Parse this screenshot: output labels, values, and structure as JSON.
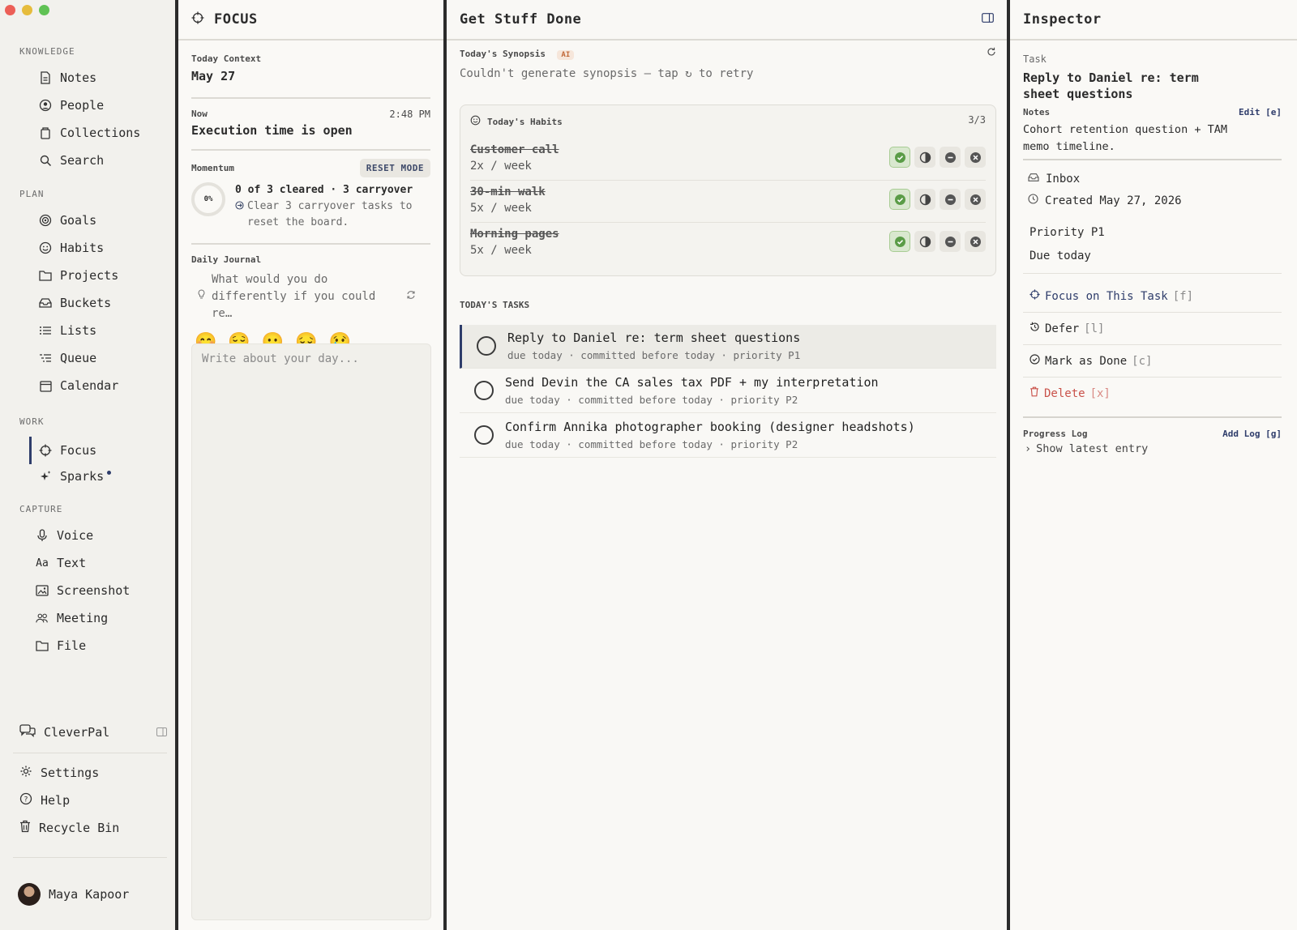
{
  "window": {
    "traffic_colors": [
      "#ec5f57",
      "#e6bc3c",
      "#60c254"
    ]
  },
  "sidebar": {
    "sections": {
      "knowledge": "KNOWLEDGE",
      "plan": "PLAN",
      "work": "WORK",
      "capture": "CAPTURE"
    },
    "knowledge": [
      {
        "label": "Notes",
        "icon": "document-icon"
      },
      {
        "label": "People",
        "icon": "person-circle-icon"
      },
      {
        "label": "Collections",
        "icon": "bucket-icon"
      },
      {
        "label": "Search",
        "icon": "search-icon"
      }
    ],
    "plan": [
      {
        "label": "Goals",
        "icon": "target-icon"
      },
      {
        "label": "Habits",
        "icon": "smile-icon"
      },
      {
        "label": "Projects",
        "icon": "folder-icon"
      },
      {
        "label": "Buckets",
        "icon": "tray-icon"
      },
      {
        "label": "Lists",
        "icon": "list-icon"
      },
      {
        "label": "Queue",
        "icon": "queue-icon"
      },
      {
        "label": "Calendar",
        "icon": "calendar-icon"
      }
    ],
    "work": [
      {
        "label": "Focus",
        "icon": "crosshair-icon",
        "active": true
      },
      {
        "label": "Sparks",
        "icon": "sparkle-icon"
      }
    ],
    "capture": [
      {
        "label": "Voice",
        "icon": "mic-icon"
      },
      {
        "label": "Text",
        "icon": "text-icon",
        "glyph": "Aa"
      },
      {
        "label": "Screenshot",
        "icon": "image-icon"
      },
      {
        "label": "Meeting",
        "icon": "people-icon"
      },
      {
        "label": "File",
        "icon": "folder-icon"
      }
    ],
    "assistant": "CleverPal",
    "settings": "Settings",
    "help": "Help",
    "recycle": "Recycle Bin",
    "user": "Maya Kapoor"
  },
  "focus": {
    "title": "FOCUS",
    "context_label": "Today Context",
    "date": "May 27",
    "now_label": "Now",
    "time": "2:48 PM",
    "status": "Execution time is open",
    "momentum_label": "Momentum",
    "reset_label": "RESET MODE",
    "percent": "0%",
    "cleared": "0 of 3 cleared · 3 carryover",
    "carryover_hint": "Clear 3 carryover tasks to reset the board.",
    "journal_label": "Daily Journal",
    "journal_prompt": "What would you do differently if you could re…",
    "moods": [
      "😊",
      "😌",
      "😐",
      "😔",
      "😢"
    ],
    "journal_placeholder": "Write about your day..."
  },
  "main": {
    "title": "Get Stuff Done",
    "synopsis_label": "Today's Synopsis",
    "ai_badge": "AI",
    "synopsis_text": "Couldn't generate synopsis — tap ↻ to retry",
    "habits_title": "Today's Habits",
    "habits_count": "3/3",
    "habits": [
      {
        "name": "Customer call",
        "freq": "2x / week"
      },
      {
        "name": "30-min walk",
        "freq": "5x / week"
      },
      {
        "name": "Morning pages",
        "freq": "5x / week"
      }
    ],
    "tasks_label": "TODAY'S TASKS",
    "tasks": [
      {
        "title": "Reply to Daniel re: term sheet questions",
        "meta": "due today · committed before today · priority P1",
        "selected": true
      },
      {
        "title": "Send Devin the CA sales tax PDF + my interpretation",
        "meta": "due today · committed before today · priority P2"
      },
      {
        "title": "Confirm Annika photographer booking (designer headshots)",
        "meta": "due today · committed before today · priority P2"
      }
    ]
  },
  "inspector": {
    "title": "Inspector",
    "type_label": "Task",
    "task_title": "Reply to Daniel re: term sheet questions",
    "notes_label": "Notes",
    "edit_label": "Edit",
    "edit_key": "[e]",
    "notes": "Cohort retention question + TAM memo timeline.",
    "bucket": "Inbox",
    "created": "Created May 27, 2026",
    "priority": "Priority P1",
    "due": "Due today",
    "focus_action": "Focus on This Task",
    "focus_key": "[f]",
    "defer_action": "Defer",
    "defer_key": "[l]",
    "done_action": "Mark as Done",
    "done_key": "[c]",
    "delete_action": "Delete",
    "delete_key": "[x]",
    "log_label": "Progress Log",
    "add_log": "Add Log",
    "add_log_key": "[g]",
    "show_latest": "Show latest entry"
  },
  "colors": {
    "accent": "#2f3d6b",
    "delete": "#c9524a",
    "check": "#5a9c47"
  }
}
